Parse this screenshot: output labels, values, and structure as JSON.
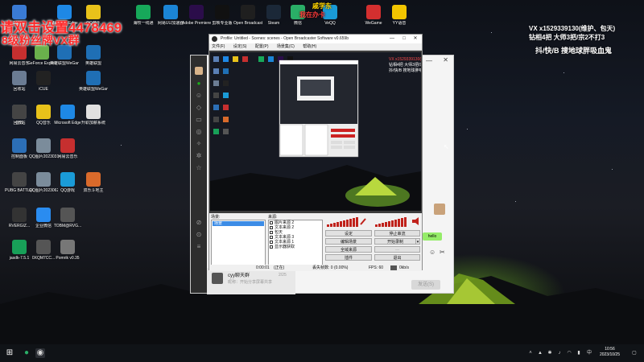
{
  "overlay": {
    "left_line1": "请双击设置4478469",
    "left_line2": "8级粉丝牌VX群",
    "top_badge_line1": "戚学东",
    "top_badge_line2": "我在办卡",
    "right_line1": "VX x1529339130(维护、包天)",
    "right_line2": "钻相4把 大师3把/宗2不打3",
    "right_line3": "抖/快/B 搜地球胖吸血鬼"
  },
  "desktop_icons": [
    {
      "label": "2023...",
      "color": "#3a7bd5"
    },
    {
      "label": "Microsoft Edge",
      "color": "#1e88e5"
    },
    {
      "label": "QQ音乐",
      "color": "#e8c21a"
    },
    {
      "label": "网易云音乐",
      "color": "#c62f2f"
    },
    {
      "label": "GeForce Experience",
      "color": "#6ab04c"
    },
    {
      "label": "英雄联盟WeGame版",
      "color": "#1f6fb5"
    },
    {
      "label": "英雄联盟",
      "color": "#1f6fb5"
    },
    {
      "label": "回收站",
      "color": "#6b7c93"
    },
    {
      "label": "iCUE",
      "color": "#222"
    },
    {
      "label": "英雄联盟WeGame版",
      "color": "#1f6fb5"
    },
    {
      "label": "回收站",
      "color": "#6b7c93"
    },
    {
      "label": "QQ音乐",
      "color": "#e8c21a"
    },
    {
      "label": "Microsoft Edge",
      "color": "#1e88e5"
    },
    {
      "label": "升职加薪系统",
      "color": "#e0e0e0"
    },
    {
      "label": "音效",
      "color": "#444"
    },
    {
      "label": "控制面板",
      "color": "#2c6fb7"
    },
    {
      "label": "QQ图片20230314...",
      "color": "#7b8c9b"
    },
    {
      "label": "网易云音乐",
      "color": "#c62f2f"
    },
    {
      "label": "PUBG BATTLEGR...",
      "color": "#444"
    },
    {
      "label": "QQ图片20230622...",
      "color": "#7b8c9b"
    },
    {
      "label": "QQ游戏",
      "color": "#1a9bd7"
    },
    {
      "label": "双乐斗地主",
      "color": "#d96a2b"
    },
    {
      "label": "RVERGIZ...",
      "color": "#333"
    },
    {
      "label": "企业微信",
      "color": "#2a8cf0"
    },
    {
      "label": "TOBM@RVG...",
      "color": "#555"
    },
    {
      "label": "jasdk-7.5.1",
      "color": "#18a058"
    },
    {
      "label": "0XQM7CC...",
      "color": "#555"
    },
    {
      "label": "Pomrik v0.35",
      "color": "#777"
    },
    {
      "label": "海牧一线通",
      "color": "#17a85a"
    },
    {
      "label": "网易UU加速器",
      "color": "#1b85d6"
    },
    {
      "label": "Adobe Premiere...",
      "color": "#2b0d4a"
    },
    {
      "label": "剪映专业版",
      "color": "#111"
    },
    {
      "label": "Open Broadcaster...",
      "color": "#1f1f1f"
    },
    {
      "label": "Steam",
      "color": "#1b2838"
    },
    {
      "label": "微信",
      "color": "#2aae67"
    },
    {
      "label": "VeQQ",
      "color": "#1a9bd7"
    },
    {
      "label": "WeGame",
      "color": "#d32f2f"
    },
    {
      "label": "YY语音",
      "color": "#f2c500"
    }
  ],
  "obs": {
    "title": "Profile: Untitled - Scenes: scenes - Open Broadcaster Software v0.659b",
    "menu": [
      "文件(F)",
      "设定(S)",
      "配置(P)",
      "场景集(C)",
      "帮助(H)"
    ],
    "scenes_label": "场景:",
    "scenes": [
      "场景"
    ],
    "sources_label": "来源:",
    "sources": [
      "图片来源 2",
      "文本来源 2",
      "包天",
      "文本来源 3",
      "文本来源 1",
      "显示器获取"
    ],
    "buttons": {
      "settings": "设定",
      "stop_stream": "停止串流",
      "edit_scene": "编辑场景",
      "start_record": "开始录制",
      "global_sources": "全域来源",
      "plugins": "插件",
      "exit": "退出"
    },
    "status": {
      "time": "0:00:01",
      "status_text": "(正在)",
      "dropped": "丢失帧数: 0 (0.00%)",
      "fps": "FPS: 60",
      "bitrate": "0kb/s"
    }
  },
  "chat": {
    "name": "cyy聊天群",
    "preview": "昵称：开始分享屏幕共享",
    "time": "2/25",
    "send": "发送(S)",
    "bubble": "hello"
  },
  "taskbar": {
    "time": "10:56",
    "date": "2023/10/25",
    "lang": "中"
  }
}
